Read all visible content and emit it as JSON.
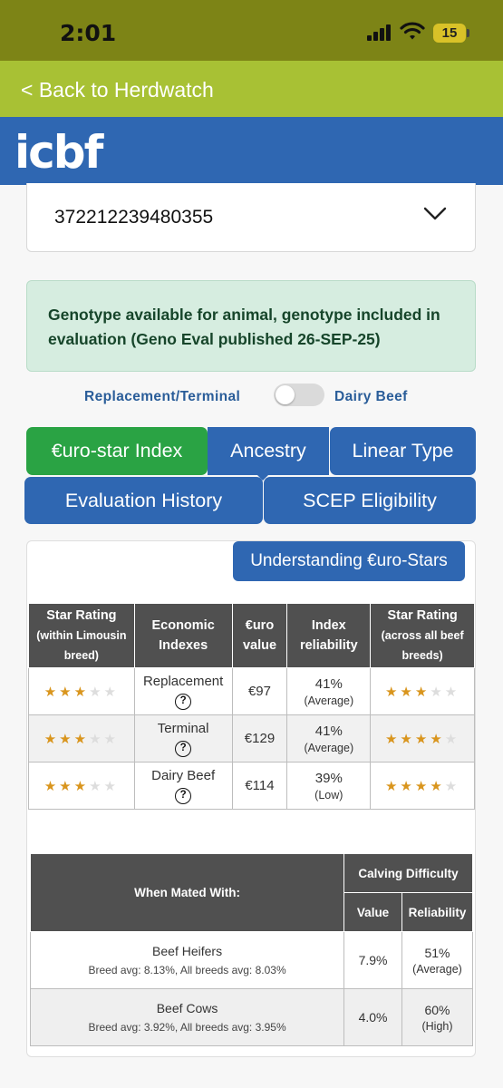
{
  "status_bar": {
    "time": "2:01",
    "battery": "15"
  },
  "nav": {
    "back_label": "< Back to Herdwatch",
    "logo_text": "icbf"
  },
  "animal_select": {
    "value": "372212239480355"
  },
  "genotype_alert": {
    "text": "Genotype available for animal, genotype included in evaluation (Geno Eval published 26-SEP-25)"
  },
  "toggle": {
    "left_label": "Replacement/Terminal",
    "right_label": "Dairy Beef",
    "state": "off"
  },
  "tabs": [
    {
      "label": "€uro-star Index",
      "active": true
    },
    {
      "label": "Ancestry",
      "active": false
    },
    {
      "label": "Linear Type",
      "active": false
    },
    {
      "label": "Evaluation History",
      "active": false
    },
    {
      "label": "SCEP Eligibility",
      "active": false
    }
  ],
  "understanding_button": "Understanding €uro-Stars",
  "stars_table": {
    "headers": {
      "within_title": "Star Rating",
      "within_sub": "(within Limousin breed)",
      "indexes": "Economic Indexes",
      "euro": "€uro value",
      "reliability": "Index reliability",
      "across_title": "Star Rating",
      "across_sub": "(across all beef breeds)"
    },
    "help_icon": "?",
    "rows": [
      {
        "within_stars": 3,
        "index": "Replacement",
        "euro": "€97",
        "reliability": "41%",
        "reliability_level": "(Average)",
        "across_stars": 3
      },
      {
        "within_stars": 3,
        "index": "Terminal",
        "euro": "€129",
        "reliability": "41%",
        "reliability_level": "(Average)",
        "across_stars": 4
      },
      {
        "within_stars": 3,
        "index": "Dairy Beef",
        "euro": "€114",
        "reliability": "39%",
        "reliability_level": "(Low)",
        "across_stars": 4
      }
    ]
  },
  "mating_table": {
    "headers": {
      "mated_with": "When Mated With:",
      "calving": "Calving Difficulty",
      "value": "Value",
      "reliability": "Reliability"
    },
    "rows": [
      {
        "group": "Beef Heifers",
        "averages": "Breed avg: 8.13%, All breeds avg: 8.03%",
        "value": "7.9%",
        "reliability": "51%",
        "reliability_level": "(Average)"
      },
      {
        "group": "Beef Cows",
        "averages": "Breed avg: 3.92%, All breeds avg: 3.95%",
        "value": "4.0%",
        "reliability": "60%",
        "reliability_level": "(High)"
      }
    ]
  },
  "colors": {
    "status_bar": "#7d8416",
    "herdwatch_green": "#a8c134",
    "icbf_blue": "#2f67b2",
    "active_tab_green": "#2aa344",
    "star_gold": "#d9951d"
  }
}
